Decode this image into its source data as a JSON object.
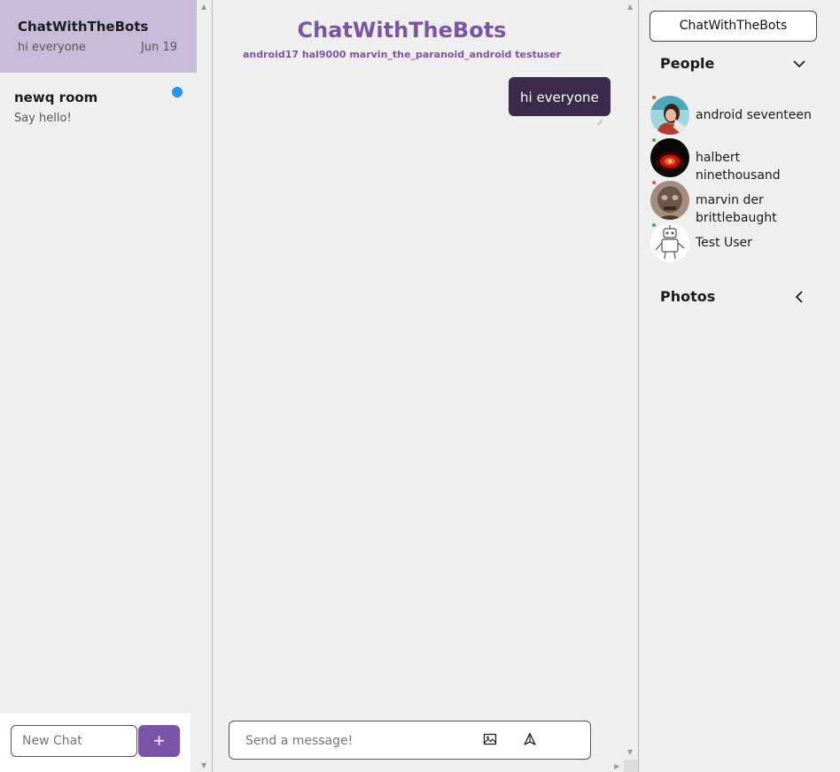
{
  "sidebar": {
    "chats": [
      {
        "title": "ChatWithTheBots",
        "last_message": "hi everyone",
        "date": "Jun 19",
        "active": true
      },
      {
        "title": "newq room",
        "last_message": "Say hello!",
        "unread": true
      }
    ],
    "new_chat_placeholder": "New Chat",
    "add_label": "+"
  },
  "room": {
    "title": "ChatWithTheBots",
    "members": "android17 hal9000 marvin_the_paranoid_android testuser",
    "messages": [
      {
        "text": "hi everyone",
        "own": true
      }
    ],
    "message_placeholder": "Send a message!"
  },
  "details": {
    "room_button": "ChatWithTheBots",
    "people_heading": "People",
    "people": [
      {
        "name": "android seventeen",
        "status": "offline"
      },
      {
        "name": "halbert ninethousand",
        "status": "online"
      },
      {
        "name": "marvin der brittlebaught",
        "status": "offline"
      },
      {
        "name": "Test User",
        "status": "online"
      }
    ],
    "photos_heading": "Photos"
  },
  "colors": {
    "accent": "#7a54a7",
    "active_chat_bg": "#c8bad9",
    "bubble_bg": "#3b2a4c",
    "unread_dot": "#2196f3",
    "online": "#3cb043",
    "offline": "#d9534f"
  }
}
